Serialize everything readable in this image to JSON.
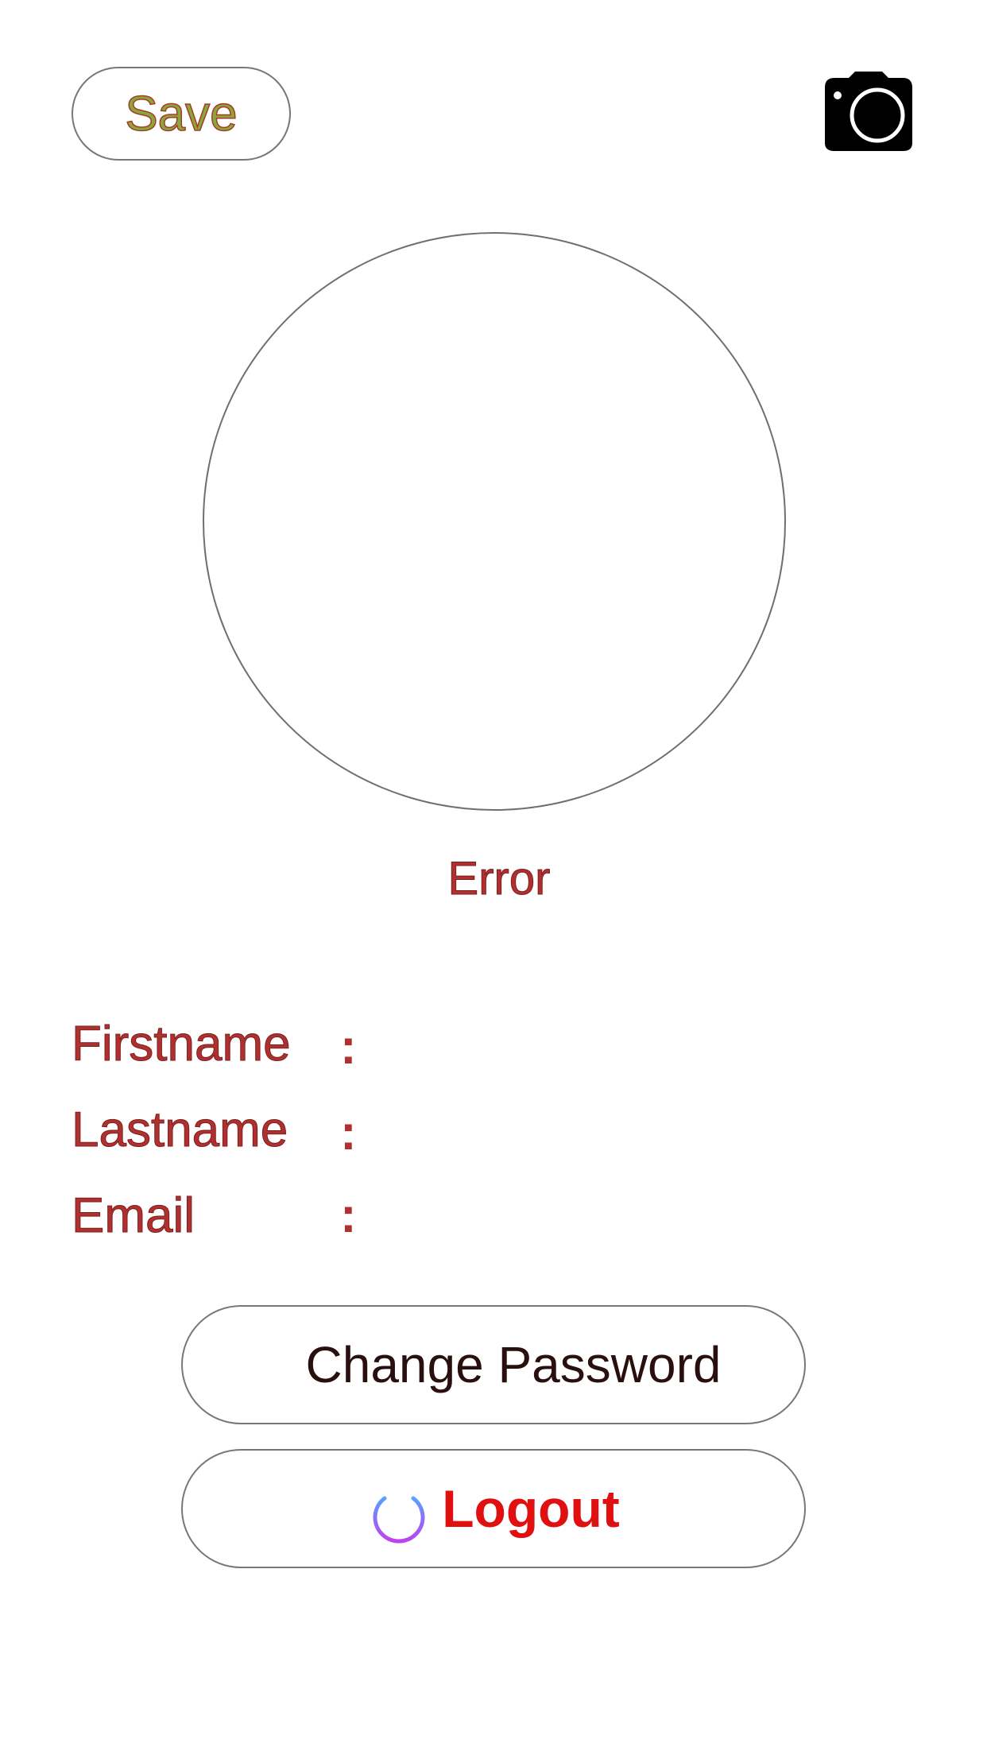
{
  "header": {
    "save_label": "Save",
    "camera_icon": "camera-icon"
  },
  "profile": {
    "status_text": "Error"
  },
  "fields": {
    "firstname": {
      "label": "Firstname",
      "separator": ":",
      "value": ""
    },
    "lastname": {
      "label": "Lastname",
      "separator": ":",
      "value": ""
    },
    "email": {
      "label": "Email",
      "separator": ":",
      "value": ""
    }
  },
  "actions": {
    "change_password_label": "Change Password",
    "logout_label": "Logout",
    "logout_icon": "power-icon"
  },
  "colors": {
    "label_red": "#b03030",
    "logout_red": "#e01010",
    "save_green": "#8aa83a",
    "border_gray": "#777777"
  }
}
